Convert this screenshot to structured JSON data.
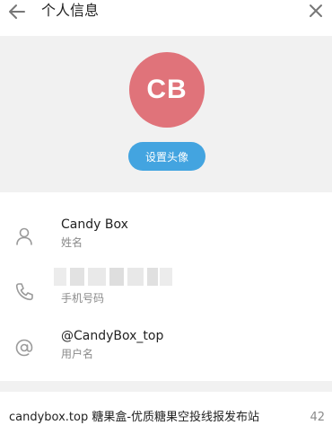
{
  "header": {
    "title": "个人信息",
    "back_icon": "arrow-left-icon",
    "close_icon": "close-icon"
  },
  "profile": {
    "avatar_initials": "CB",
    "avatar_color": "#e0737a",
    "set_avatar_label": "设置头像",
    "button_color": "#43a4e0"
  },
  "info": {
    "name": {
      "value": "Candy Box",
      "label": "姓名",
      "icon": "user-icon"
    },
    "phone": {
      "value": "",
      "label": "手机号码",
      "icon": "phone-icon"
    },
    "username": {
      "value": "@CandyBox_top",
      "label": "用户名",
      "icon": "at-sign-icon"
    }
  },
  "footer": {
    "text": "candybox.top 糖果盒-优质糖果空投线报发布站",
    "count": "42"
  }
}
